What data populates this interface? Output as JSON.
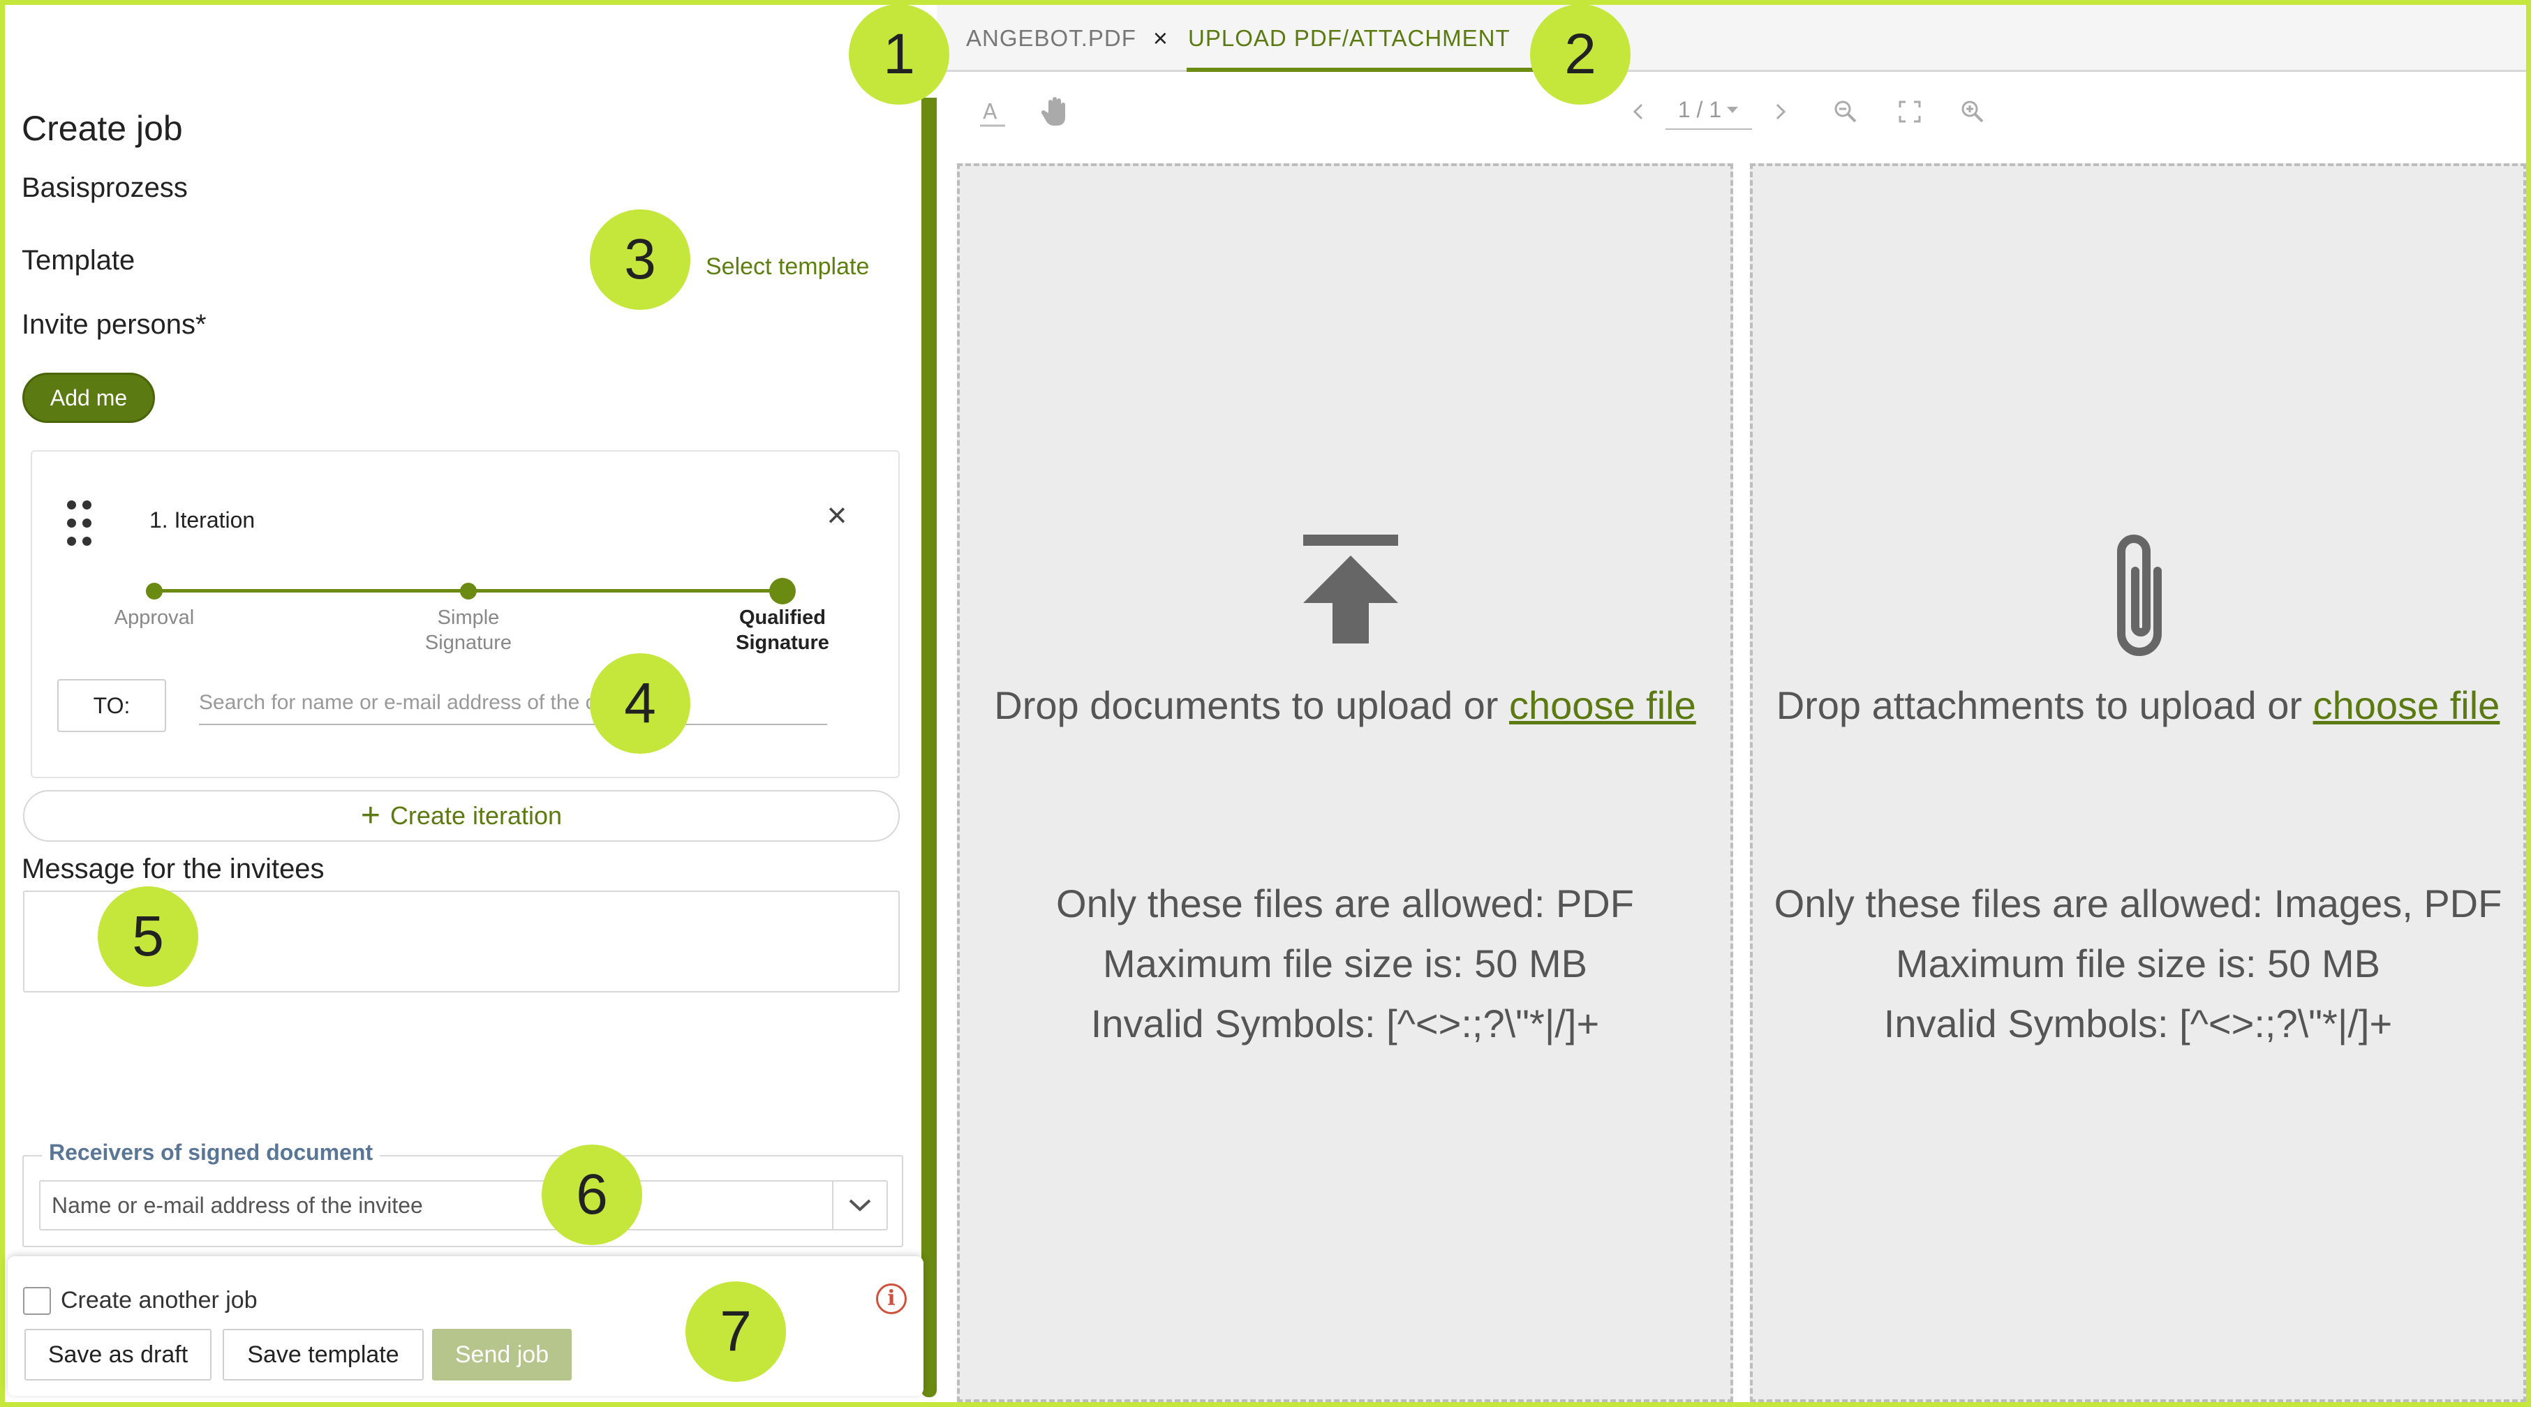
{
  "left_panel": {
    "title": "Create job",
    "process": "Basisprozess",
    "template_label": "Template",
    "select_template": "Select template",
    "invite_label": "Invite persons*",
    "add_me": "Add me",
    "iteration": {
      "title": "1. Iteration",
      "steps": [
        {
          "line1": "Approval",
          "line2": ""
        },
        {
          "line1": "Simple",
          "line2": "Signature"
        },
        {
          "line1": "Qualified",
          "line2": "Signature"
        }
      ],
      "selected_step": "Qualified Signature",
      "to_button": "TO:",
      "search_placeholder": "Search for name or e-mail address of the contact"
    },
    "create_iteration": "Create iteration",
    "message_label": "Message for the invitees",
    "message_value": "",
    "receivers_legend": "Receivers of signed document",
    "receivers_placeholder": "Name or e-mail address of the invitee",
    "create_another_job": "Create another job",
    "create_another_checked": false,
    "buttons": {
      "save_draft": "Save as draft",
      "save_template": "Save template",
      "send_job": "Send job"
    }
  },
  "tabs": [
    {
      "label": "ANGEBOT.PDF",
      "closable": true,
      "active": false
    },
    {
      "label": "UPLOAD PDF/ATTACHMENT",
      "closable": false,
      "active": true
    }
  ],
  "toolbar": {
    "page_indicator": "1 / 1",
    "icons": [
      "text-select-icon",
      "hand-pan-icon",
      "chevron-left-icon",
      "chevron-right-icon",
      "zoom-out-icon",
      "fullscreen-icon",
      "zoom-in-icon"
    ]
  },
  "documents_drop": {
    "text": "Drop documents to upload or",
    "link": "choose file",
    "allowed": "Only these files are allowed: PDF",
    "max_size": "Maximum file size is: 50 MB",
    "invalid": "Invalid Symbols: [^<>:;?\\\"*|/]+"
  },
  "attachments_drop": {
    "text": "Drop attachments to upload or",
    "link": "choose file",
    "allowed": "Only these files are allowed: Images, PDF",
    "max_size": "Maximum file size is: 50 MB",
    "invalid": "Invalid Symbols: [^<>:;?\\\"*|/]+"
  },
  "callouts": [
    "1",
    "2",
    "3",
    "4",
    "5",
    "6",
    "7"
  ],
  "colors": {
    "accent": "#6b8a12",
    "accent_text": "#5b7a11",
    "callout": "#c5e63a",
    "drop_bg": "#ececec",
    "send_disabled": "#b6c58b",
    "info": "#d0503b"
  }
}
